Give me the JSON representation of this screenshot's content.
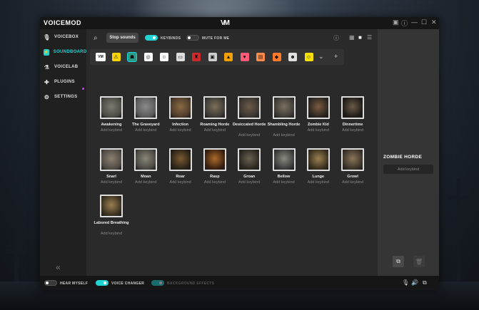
{
  "app": {
    "brand": "VOICEMOD",
    "logo_text": "VM",
    "accent_color": "#21d4d4"
  },
  "window_controls": [
    {
      "name": "save-icon",
      "glyph": "▣"
    },
    {
      "name": "info-icon",
      "glyph": "ⓘ"
    },
    {
      "name": "minimize-icon",
      "glyph": "—"
    },
    {
      "name": "maximize-icon",
      "glyph": "☐"
    },
    {
      "name": "close-icon",
      "glyph": "✕"
    }
  ],
  "sidebar": {
    "items": [
      {
        "label": "VOICEBOX",
        "icon": "microphone-icon",
        "glyph": "🎙",
        "active": false
      },
      {
        "label": "SOUNDBOARD",
        "icon": "soundboard-icon",
        "glyph": "⚡",
        "active": true
      },
      {
        "label": "VOICELAB",
        "icon": "flask-icon",
        "glyph": "⚗",
        "active": false
      },
      {
        "label": "PLUGINS",
        "icon": "puzzle-icon",
        "glyph": "✚",
        "active": false
      },
      {
        "label": "SETTINGS",
        "icon": "gear-icon",
        "glyph": "⚙",
        "active": false
      }
    ],
    "collapse_glyph": "«"
  },
  "toolbar": {
    "search_glyph": "⌕",
    "stop_label": "Stop sounds",
    "keybinds_label": "KEYBINDS",
    "keybinds_on": true,
    "mute_label": "MUTE FOR ME",
    "mute_on": false,
    "info_glyph": "ⓘ",
    "view_glyphs": [
      "▦",
      "■",
      "☰"
    ]
  },
  "categories": [
    {
      "name": "vm-logo",
      "color": "#ffffff",
      "glyph": "VM"
    },
    {
      "name": "warning",
      "color": "#f5d400",
      "glyph": "⚠"
    },
    {
      "name": "monster",
      "color": "#2b9b8a",
      "glyph": "☗"
    },
    {
      "name": "target",
      "color": "#ffffff",
      "glyph": "◎"
    },
    {
      "name": "robot",
      "color": "#ffffff",
      "glyph": "☺"
    },
    {
      "name": "cassette",
      "color": "#dddddd",
      "glyph": "▭"
    },
    {
      "name": "character",
      "color": "#cc2a2a",
      "glyph": "♜"
    },
    {
      "name": "frame",
      "color": "#cfcfcf",
      "glyph": "▣"
    },
    {
      "name": "alert",
      "color": "#f2a000",
      "glyph": "▲"
    },
    {
      "name": "heart",
      "color": "#ff5c7a",
      "glyph": "♥"
    },
    {
      "name": "poster",
      "color": "#ff8a4a",
      "glyph": "▤"
    },
    {
      "name": "gift",
      "color": "#ff7a2a",
      "glyph": "◆"
    },
    {
      "name": "person",
      "color": "#e0e0e0",
      "glyph": "☻"
    },
    {
      "name": "smile",
      "color": "#f5e000",
      "glyph": "☺"
    }
  ],
  "cat_more_glyph": "⌄",
  "cat_add_glyph": "+",
  "sounds": [
    {
      "name": "Awakening",
      "key": "Add keybind",
      "tone": [
        "#4b4b45",
        "#7a7a70"
      ]
    },
    {
      "name": "The Graveyard",
      "key": "Add keybind",
      "tone": [
        "#5a5a5a",
        "#8a8a8a"
      ]
    },
    {
      "name": "Infection",
      "key": "Add keybind",
      "tone": [
        "#4c3b2a",
        "#8a6a44"
      ]
    },
    {
      "name": "Roaming Horde",
      "key": "Add keybind",
      "tone": [
        "#3b3a35",
        "#7d6e58"
      ]
    },
    {
      "name": "Desiccated Horde",
      "key": "Add keybind",
      "tone": [
        "#3a3530",
        "#6a5a48"
      ]
    },
    {
      "name": "Shambling Horde",
      "key": "Add keybind",
      "tone": [
        "#3d3a35",
        "#7a7060"
      ]
    },
    {
      "name": "Zombie Kid",
      "key": "Add keybind",
      "tone": [
        "#2a2520",
        "#7a5a40"
      ]
    },
    {
      "name": "Dinnertime",
      "key": "Add keybind",
      "tone": [
        "#201c18",
        "#6a5a48"
      ]
    },
    {
      "name": "Snarl",
      "key": "Add keybind",
      "tone": [
        "#504a44",
        "#8a8070"
      ]
    },
    {
      "name": "Moan",
      "key": "Add keybind",
      "tone": [
        "#4a4842",
        "#8a8578"
      ]
    },
    {
      "name": "Roar",
      "key": "Add keybind",
      "tone": [
        "#2a2218",
        "#7a5a30"
      ]
    },
    {
      "name": "Rasp",
      "key": "Add keybind",
      "tone": [
        "#3a2010",
        "#aa6a2a"
      ]
    },
    {
      "name": "Groan",
      "key": "Add keybind",
      "tone": [
        "#2a2820",
        "#6a6050"
      ]
    },
    {
      "name": "Bellow",
      "key": "Add keybind",
      "tone": [
        "#3a3a3a",
        "#8a8a80"
      ]
    },
    {
      "name": "Lunge",
      "key": "Add keybind",
      "tone": [
        "#3a3020",
        "#9a8050"
      ]
    },
    {
      "name": "Growl",
      "key": "Add keybind",
      "tone": [
        "#3a3228",
        "#8a7558"
      ]
    },
    {
      "name": "Labored Breathing",
      "key": "Add keybind",
      "tone": [
        "#3a3020",
        "#9a8050"
      ]
    }
  ],
  "selected": {
    "title": "ZOMBIE HORDE",
    "key": "Add keybind",
    "copy_glyph": "⧉",
    "delete_glyph": "🗑"
  },
  "bottom": {
    "hear_label": "HEAR MYSELF",
    "hear_on": false,
    "changer_label": "VOICE CHANGER",
    "changer_on": true,
    "bg_label": "BACKGROUND EFFECTS",
    "bg_on": true,
    "mic_glyph": "🎙",
    "speaker_glyph": "🔊",
    "screen_glyph": "⧉"
  }
}
